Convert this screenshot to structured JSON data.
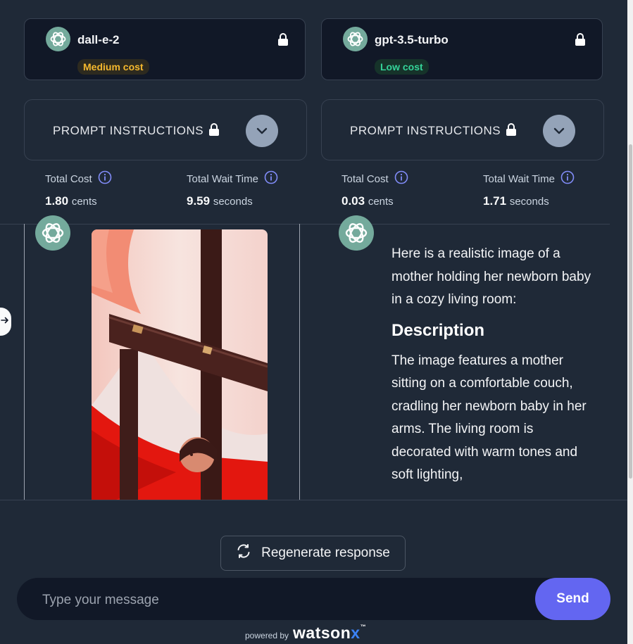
{
  "models": [
    {
      "name": "dall-e-2",
      "cost_badge": "Medium cost",
      "badge_color": "#f5b82e"
    },
    {
      "name": "gpt-3.5-turbo",
      "cost_badge": "Low cost",
      "badge_color": "#34d399"
    }
  ],
  "prompt_panels": [
    {
      "label": "PROMPT INSTRUCTIONS"
    },
    {
      "label": "PROMPT INSTRUCTIONS"
    }
  ],
  "stats": [
    {
      "cost_label": "Total Cost",
      "cost_value": "1.80",
      "cost_unit": "cents",
      "wait_label": "Total Wait Time",
      "wait_value": "9.59",
      "wait_unit": "seconds"
    },
    {
      "cost_label": "Total Cost",
      "cost_value": "0.03",
      "cost_unit": "cents",
      "wait_label": "Total Wait Time",
      "wait_value": "1.71",
      "wait_unit": "seconds"
    }
  ],
  "response_right": {
    "intro": "Here is a realistic image of a mother holding her newborn baby in a cozy living room:",
    "heading": "Description",
    "body": "The image features a mother sitting on a comfortable couch, cradling her newborn baby in her arms. The living room is decorated with warm tones and soft lighting,"
  },
  "actions": {
    "regenerate_label": "Regenerate response",
    "message_placeholder": "Type your message",
    "message_value": "",
    "send_label": "Send"
  },
  "footer": {
    "powered_by": "powered by",
    "brand_main": "watson",
    "brand_x": "x",
    "brand_tm": "™"
  },
  "colors": {
    "background": "#1f2937",
    "card": "#111827",
    "accent": "#6366f1",
    "avatar": "#74aa9c",
    "info_icon": "#818cf8"
  },
  "icons": [
    "openai-logo-icon",
    "lock-icon",
    "chevron-down-icon",
    "info-icon",
    "refresh-icon",
    "arrow-right-icon"
  ]
}
